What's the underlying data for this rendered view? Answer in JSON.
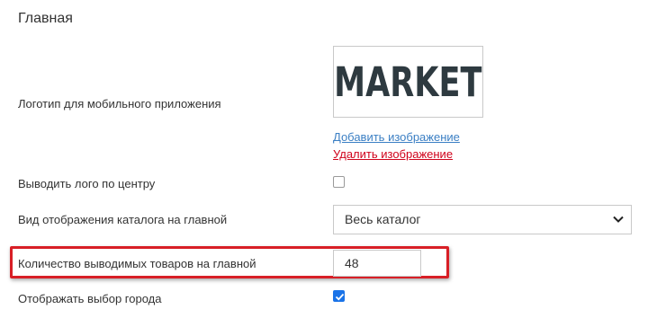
{
  "section": {
    "title": "Главная"
  },
  "logo": {
    "label": "Логотип для мобильного приложения",
    "image_text": "MARKET",
    "add_link": "Добавить изображение",
    "delete_link": "Удалить изображение"
  },
  "center_logo": {
    "label": "Выводить лого по центру",
    "checked": false
  },
  "catalog_view": {
    "label": "Вид отображения каталога на главной",
    "selected": "Весь каталог"
  },
  "products_count": {
    "label": "Количество выводимых товаров на главной",
    "value": "48"
  },
  "city_select": {
    "label": "Отображать выбор города",
    "checked": true
  },
  "colors": {
    "link_add": "#3b7fc4",
    "link_delete": "#d0021b",
    "highlight": "#d81f26",
    "checkbox_checked": "#1a73e8",
    "logo_text": "#2e3a40"
  }
}
